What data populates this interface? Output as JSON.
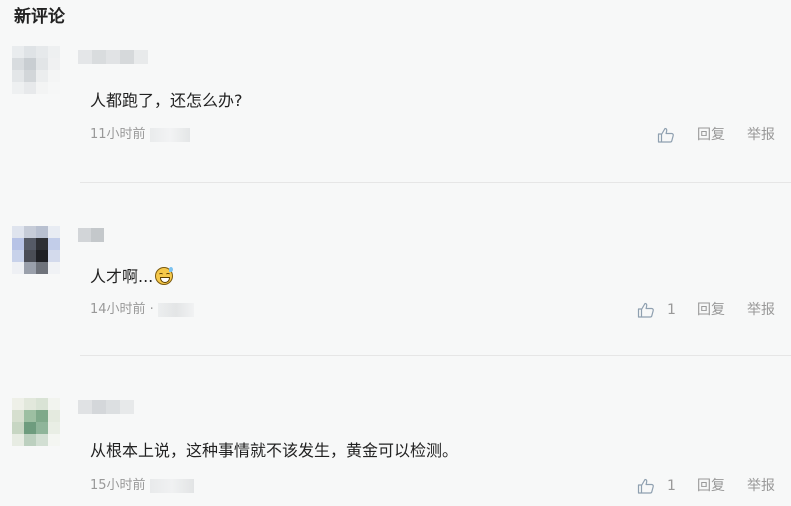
{
  "section": {
    "title": "新评论"
  },
  "comments": [
    {
      "text": "人都跑了，还怎么办?",
      "time": "11小时前",
      "likes": "",
      "reply_label": "回复",
      "report_label": "举报"
    },
    {
      "text": "人才啊...",
      "emoji": "grinning-sweat-emoji",
      "time": "14小时前 ·",
      "likes": "1",
      "reply_label": "回复",
      "report_label": "举报"
    },
    {
      "text": "从根本上说，这种事情就不该发生，黄金可以检测。",
      "time": "15小时前",
      "likes": "1",
      "reply_label": "回复",
      "report_label": "举报"
    }
  ],
  "colors": {
    "background": "#f7f8f8",
    "text": "#222222",
    "meta": "#999999",
    "divider": "#e6e6e6"
  }
}
